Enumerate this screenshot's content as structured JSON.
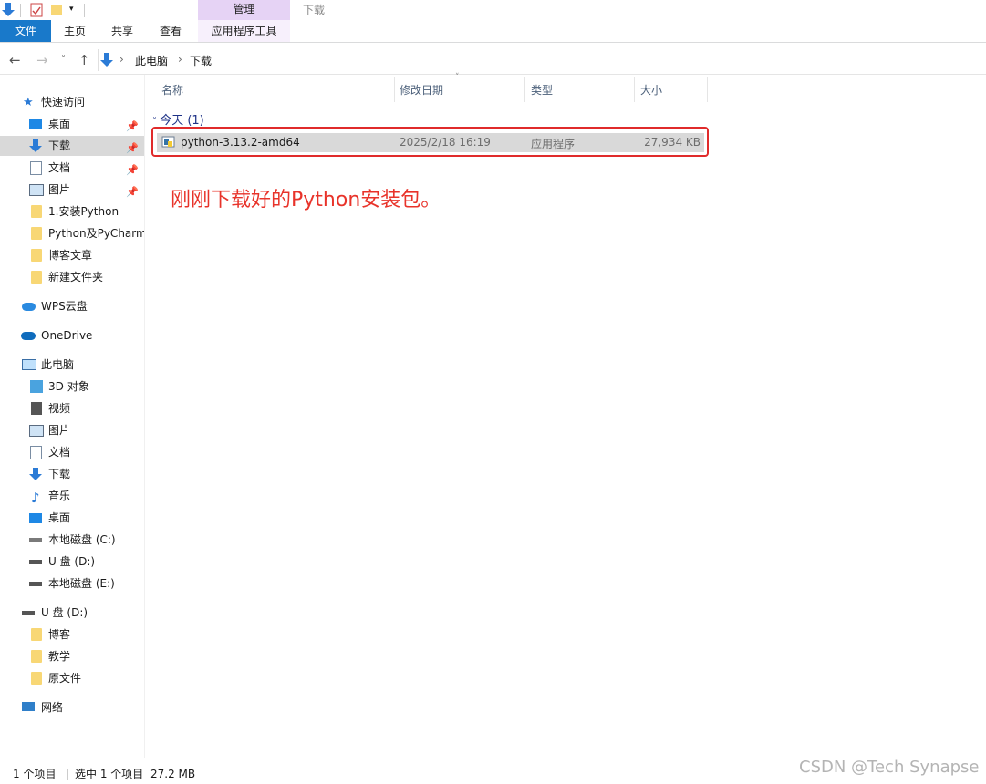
{
  "ribbon": {
    "context_tab": "管理",
    "context_subtab": "应用程序工具",
    "window_title": "下载",
    "tabs": [
      "文件",
      "主页",
      "共享",
      "查看"
    ]
  },
  "address": {
    "crumbs": [
      "此电脑",
      "下载"
    ]
  },
  "nav": {
    "quick_access": "快速访问",
    "quick_items": [
      {
        "label": "桌面",
        "pinned": true
      },
      {
        "label": "下载",
        "pinned": true,
        "selected": true
      },
      {
        "label": "文档",
        "pinned": true
      },
      {
        "label": "图片",
        "pinned": true
      },
      {
        "label": "1.安装Python"
      },
      {
        "label": "Python及PyCharm"
      },
      {
        "label": "博客文章"
      },
      {
        "label": "新建文件夹"
      }
    ],
    "wps": "WPS云盘",
    "onedrive": "OneDrive",
    "this_pc": "此电脑",
    "pc_items": [
      "3D 对象",
      "视频",
      "图片",
      "文档",
      "下载",
      "音乐",
      "桌面",
      "本地磁盘 (C:)",
      "U 盘 (D:)",
      "本地磁盘 (E:)"
    ],
    "usb": "U 盘 (D:)",
    "usb_items": [
      "博客",
      "教学",
      "原文件"
    ],
    "network": "网络"
  },
  "columns": {
    "name": "名称",
    "date": "修改日期",
    "type": "类型",
    "size": "大小"
  },
  "group": {
    "label": "今天 (1)"
  },
  "file": {
    "name": "python-3.13.2-amd64",
    "date": "2025/2/18 16:19",
    "type": "应用程序",
    "size": "27,934 KB"
  },
  "annotation": "刚刚下载好的Python安装包。",
  "status": {
    "count": "1 个项目",
    "selected": "选中 1 个项目",
    "size": "27.2 MB"
  },
  "watermark": "CSDN @Tech Synapse",
  "colors": {
    "accent": "#1979ca",
    "context_tab": "#e6d3f5",
    "highlight": "#e02b2b",
    "selection": "#d9d9d9"
  }
}
